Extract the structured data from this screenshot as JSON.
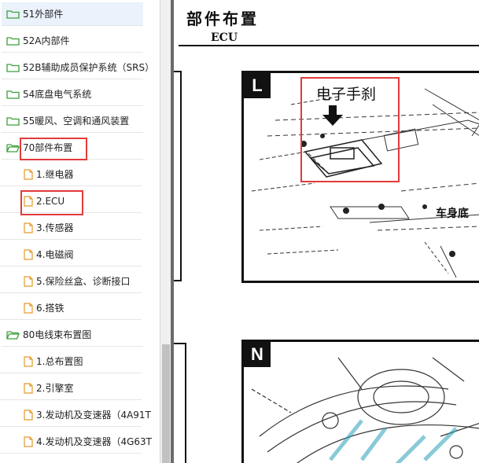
{
  "tree": {
    "items": [
      {
        "label": "51外部件",
        "kind": "folder",
        "selected": true
      },
      {
        "label": "52A内部件",
        "kind": "folder"
      },
      {
        "label": "52B辅助成员保护系统（SRS）",
        "kind": "folder"
      },
      {
        "label": "54底盘电气系统",
        "kind": "folder"
      },
      {
        "label": "55暖风、空调和通风装置",
        "kind": "folder"
      },
      {
        "label": "70部件布置",
        "kind": "folder-open"
      },
      {
        "label": "1.继电器",
        "kind": "doc"
      },
      {
        "label": "2.ECU",
        "kind": "doc"
      },
      {
        "label": "3.传感器",
        "kind": "doc"
      },
      {
        "label": "4.电磁阀",
        "kind": "doc"
      },
      {
        "label": "5.保险丝盒、诊断接口",
        "kind": "doc"
      },
      {
        "label": "6.搭铁",
        "kind": "doc"
      },
      {
        "label": "80电线束布置图",
        "kind": "folder-open"
      },
      {
        "label": "1.总布置图",
        "kind": "doc"
      },
      {
        "label": "2.引擎室",
        "kind": "doc"
      },
      {
        "label": "3.发动机及变速器（4A91T",
        "kind": "doc"
      },
      {
        "label": "4.发动机及变速器（4G63T",
        "kind": "doc"
      }
    ]
  },
  "document": {
    "title": "部件布置",
    "subtitle": "ECU",
    "panel_l": {
      "tag": "L",
      "callout": "电子手刹",
      "side_text": "车身底"
    },
    "panel_n": {
      "tag": "N"
    }
  },
  "colors": {
    "highlight": "#e23b3b",
    "folder": "#3aa13a",
    "doc": "#e39a2b",
    "selected_bg": "#eaf2fb"
  }
}
